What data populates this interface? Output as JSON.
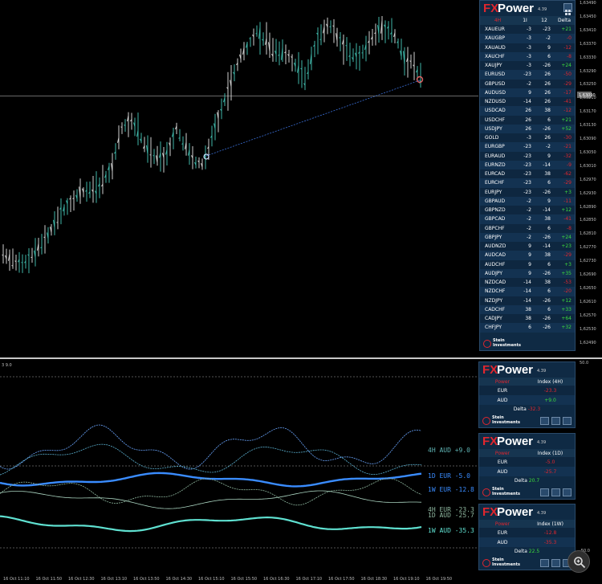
{
  "main_chart": {
    "price_axis": [
      "1,63490",
      "1,63450",
      "1,63410",
      "1,63370",
      "1,63330",
      "1,63290",
      "1,63250",
      "1,63210",
      "1,63170",
      "1,63130",
      "1,63090",
      "1,63050",
      "1,63010",
      "1,62970",
      "1,62930",
      "1,62890",
      "1,62850",
      "1,62810",
      "1,62770",
      "1,62730",
      "1,62690",
      "1,62650",
      "1,62610",
      "1,62570",
      "1,62530",
      "1,62490"
    ],
    "current_price": "1,63090"
  },
  "sub_chart": {
    "indicator_title": "3 9.0",
    "scale_top": "50.0",
    "scale_bottom": "-50.0",
    "labels": [
      {
        "text": "4H AUD  +9.0",
        "color": "#5fb4b4"
      },
      {
        "text": "1D EUR  -5.0",
        "color": "#3a8cff"
      },
      {
        "text": "1W EUR -12.8",
        "color": "#3a8cff"
      },
      {
        "text": "4H EUR -23.3",
        "color": "#8fb8a0"
      },
      {
        "text": "1D AUD -25.7",
        "color": "#8fb8a0"
      },
      {
        "text": "1W AUD -35.3",
        "color": "#5fe0d0"
      }
    ]
  },
  "time_axis": [
    "16 Oct 11:10",
    "16 Oct 11:50",
    "16 Oct 12:30",
    "16 Oct 13:10",
    "16 Oct 13:50",
    "16 Oct 14:30",
    "16 Oct 15:10",
    "16 Oct 15:50",
    "16 Oct 16:30",
    "16 Oct 17:10",
    "16 Oct 17:50",
    "16 Oct 18:30",
    "16 Oct 19:10",
    "16 Oct 19:50"
  ],
  "fx_panel": {
    "logo_fx": "FX",
    "logo_power": "Power",
    "version": "4.39",
    "col_headers": [
      "4H",
      "1I",
      "12",
      "Delta"
    ],
    "rows": [
      {
        "sym": "XAUEUR",
        "a": "-3",
        "b": "-23",
        "d": "+21",
        "sign": "pos"
      },
      {
        "sym": "XAUGBP",
        "a": "-3",
        "b": "-2",
        "d": "-0",
        "sign": "neg"
      },
      {
        "sym": "XAUAUD",
        "a": "-3",
        "b": "9",
        "d": "-12",
        "sign": "neg"
      },
      {
        "sym": "XAUCHF",
        "a": "-3",
        "b": "6",
        "d": "-8",
        "sign": "neg"
      },
      {
        "sym": "XAUJPY",
        "a": "-3",
        "b": "-26",
        "d": "+24",
        "sign": "pos"
      },
      {
        "sym": "EURUSD",
        "a": "-23",
        "b": "26",
        "d": "-50",
        "sign": "neg"
      },
      {
        "sym": "GBPUSD",
        "a": "-2",
        "b": "26",
        "d": "-29",
        "sign": "neg"
      },
      {
        "sym": "AUDUSD",
        "a": "9",
        "b": "26",
        "d": "-17",
        "sign": "neg"
      },
      {
        "sym": "NZDUSD",
        "a": "-14",
        "b": "26",
        "d": "-41",
        "sign": "neg"
      },
      {
        "sym": "USDCAD",
        "a": "26",
        "b": "38",
        "d": "-12",
        "sign": "neg"
      },
      {
        "sym": "USDCHF",
        "a": "26",
        "b": "6",
        "d": "+21",
        "sign": "pos"
      },
      {
        "sym": "USDJPY",
        "a": "26",
        "b": "-26",
        "d": "+52",
        "sign": "pos"
      },
      {
        "sym": "GOLD",
        "a": "-3",
        "b": "26",
        "d": "-30",
        "sign": "neg"
      },
      {
        "sym": "EURGBP",
        "a": "-23",
        "b": "-2",
        "d": "-21",
        "sign": "neg"
      },
      {
        "sym": "EURAUD",
        "a": "-23",
        "b": "9",
        "d": "-32",
        "sign": "neg"
      },
      {
        "sym": "EURNZD",
        "a": "-23",
        "b": "-14",
        "d": "-9",
        "sign": "neg"
      },
      {
        "sym": "EURCAD",
        "a": "-23",
        "b": "38",
        "d": "-62",
        "sign": "neg"
      },
      {
        "sym": "EURCHF",
        "a": "-23",
        "b": "6",
        "d": "-29",
        "sign": "neg"
      },
      {
        "sym": "EURJPY",
        "a": "-23",
        "b": "-26",
        "d": "+3",
        "sign": "pos"
      },
      {
        "sym": "GBPAUD",
        "a": "-2",
        "b": "9",
        "d": "-11",
        "sign": "neg"
      },
      {
        "sym": "GBPNZD",
        "a": "-2",
        "b": "-14",
        "d": "+12",
        "sign": "pos"
      },
      {
        "sym": "GBPCAD",
        "a": "-2",
        "b": "38",
        "d": "-41",
        "sign": "neg"
      },
      {
        "sym": "GBPCHF",
        "a": "-2",
        "b": "6",
        "d": "-8",
        "sign": "neg"
      },
      {
        "sym": "GBPJPY",
        "a": "-2",
        "b": "-26",
        "d": "+24",
        "sign": "pos"
      },
      {
        "sym": "AUDNZD",
        "a": "9",
        "b": "-14",
        "d": "+23",
        "sign": "pos"
      },
      {
        "sym": "AUDCAD",
        "a": "9",
        "b": "38",
        "d": "-29",
        "sign": "neg"
      },
      {
        "sym": "AUDCHF",
        "a": "9",
        "b": "6",
        "d": "+3",
        "sign": "pos"
      },
      {
        "sym": "AUDJPY",
        "a": "9",
        "b": "-26",
        "d": "+35",
        "sign": "pos"
      },
      {
        "sym": "NZDCAD",
        "a": "-14",
        "b": "38",
        "d": "-53",
        "sign": "neg"
      },
      {
        "sym": "NZDCHF",
        "a": "-14",
        "b": "6",
        "d": "-20",
        "sign": "neg"
      },
      {
        "sym": "NZDJPY",
        "a": "-14",
        "b": "-26",
        "d": "+12",
        "sign": "pos"
      },
      {
        "sym": "CADCHF",
        "a": "38",
        "b": "6",
        "d": "+33",
        "sign": "pos"
      },
      {
        "sym": "CADJPY",
        "a": "38",
        "b": "-26",
        "d": "+64",
        "sign": "pos"
      },
      {
        "sym": "CHFJPY",
        "a": "6",
        "b": "-26",
        "d": "+32",
        "sign": "pos"
      }
    ],
    "footer_line1": "Stein",
    "footer_line2": "Investments"
  },
  "mini_panels": [
    {
      "version": "4.39",
      "col1": "Power",
      "col2": "Index (4H)",
      "rows": [
        {
          "cur": "EUR",
          "val": "-23.3",
          "sign": "neg"
        },
        {
          "cur": "AUD",
          "val": "+9.0",
          "sign": "pos"
        }
      ],
      "delta_label": "Delta",
      "delta_val": "-32.3",
      "delta_sign": "neg"
    },
    {
      "version": "4.39",
      "col1": "Power",
      "col2": "Index (1D)",
      "rows": [
        {
          "cur": "EUR",
          "val": "-5.0",
          "sign": "neg"
        },
        {
          "cur": "AUD",
          "val": "-25.7",
          "sign": "neg"
        }
      ],
      "delta_label": "Delta",
      "delta_val": "20.7",
      "delta_sign": "pos"
    },
    {
      "version": "4.39",
      "col1": "Power",
      "col2": "Index (1W)",
      "rows": [
        {
          "cur": "EUR",
          "val": "-12.8",
          "sign": "neg"
        },
        {
          "cur": "AUD",
          "val": "-35.3",
          "sign": "neg"
        }
      ],
      "delta_label": "Delta",
      "delta_val": "22.5",
      "delta_sign": "pos"
    }
  ]
}
